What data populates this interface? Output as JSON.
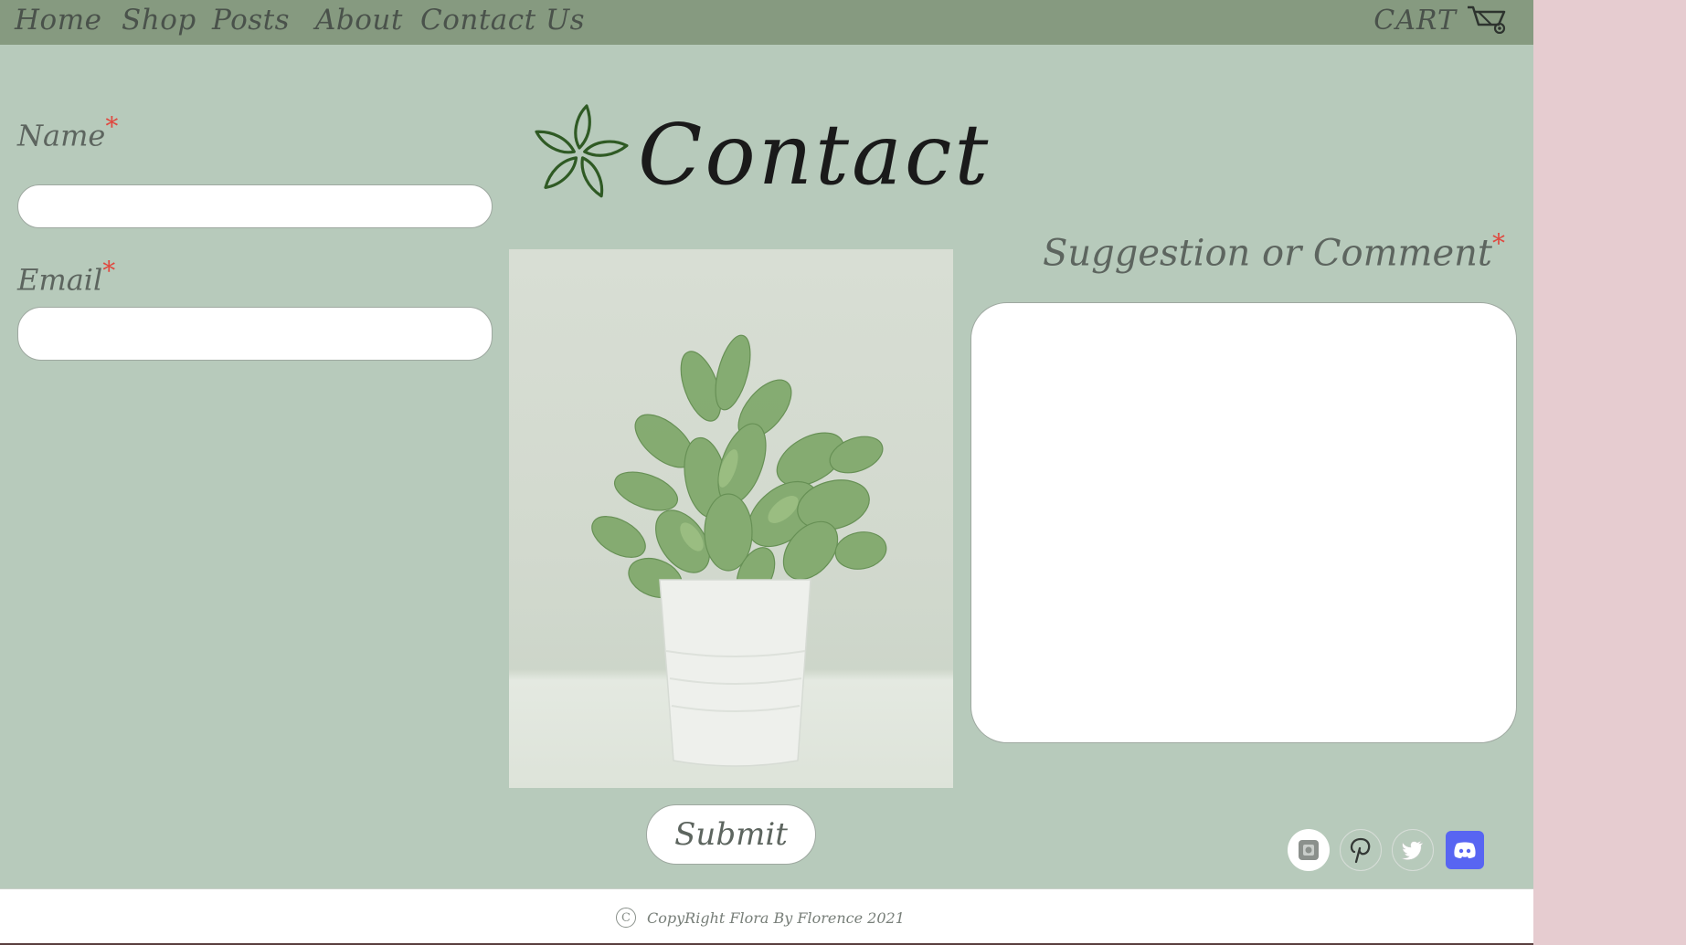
{
  "nav": {
    "items": [
      {
        "label": "Home"
      },
      {
        "label": "Shop"
      },
      {
        "label": "Posts"
      },
      {
        "label": "About"
      },
      {
        "label": "Contact Us"
      }
    ],
    "cart_label": "CART",
    "cart_icon": "cart-icon"
  },
  "form": {
    "name_label": "Name",
    "email_label": "Email",
    "comment_label": "Suggestion or Comment",
    "required_mark": "*",
    "name_value": "",
    "email_value": "",
    "comment_value": "",
    "submit_label": "Submit"
  },
  "heading": {
    "title": "Contact",
    "logo_icon": "flower-icon"
  },
  "image": {
    "subject": "potted-plant-photo"
  },
  "social": [
    {
      "icon": "instagram-icon"
    },
    {
      "icon": "pinterest-icon"
    },
    {
      "icon": "twitter-icon"
    },
    {
      "icon": "discord-icon"
    }
  ],
  "footer": {
    "copyright_icon": "copyright-icon",
    "text": "CopyRight Flora By Florence 2021"
  },
  "colors": {
    "page_bg": "#b7cabb",
    "nav_bg": "#869a80",
    "side_bg": "#e6ccd0",
    "required": "#e0483f",
    "discord": "#5865f2"
  }
}
